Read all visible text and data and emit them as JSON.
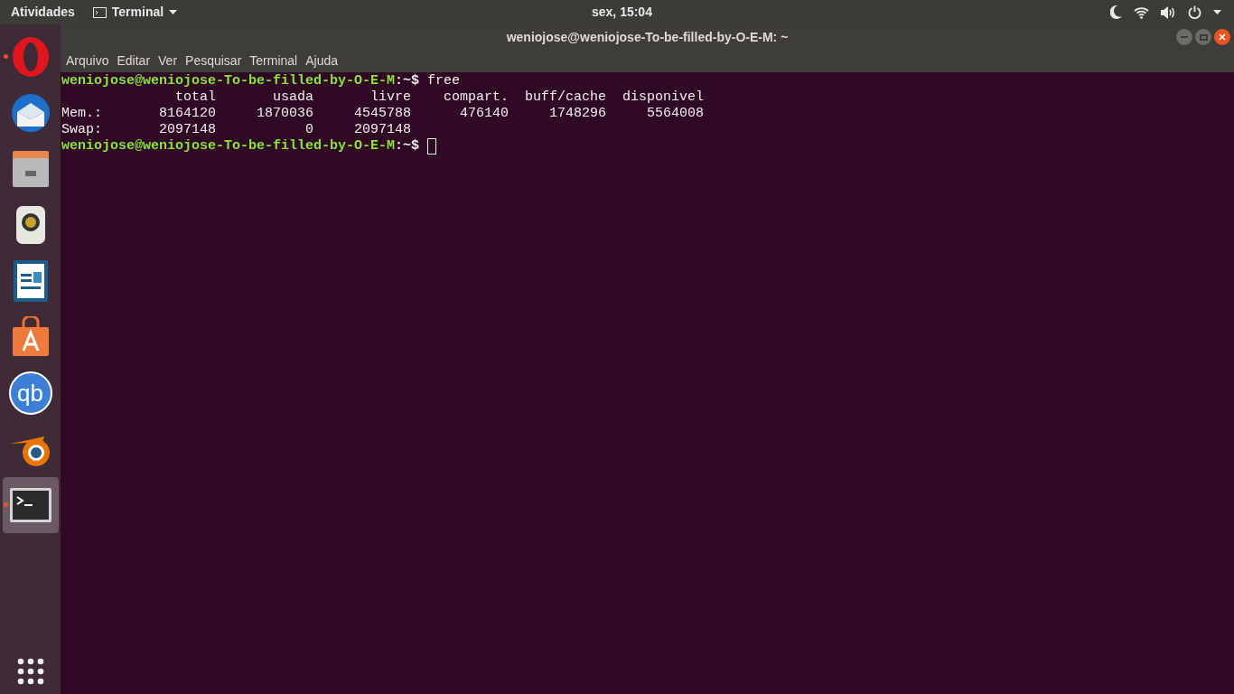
{
  "top_bar": {
    "activities": "Atividades",
    "app_menu": "Terminal",
    "clock": "sex, 15:04"
  },
  "dock": {
    "items": [
      {
        "kind": "opera",
        "running": true,
        "selected": false
      },
      {
        "kind": "thunderbird",
        "running": false,
        "selected": false
      },
      {
        "kind": "files",
        "running": false,
        "selected": false
      },
      {
        "kind": "speaker",
        "running": false,
        "selected": false
      },
      {
        "kind": "writer",
        "running": false,
        "selected": false
      },
      {
        "kind": "store",
        "running": false,
        "selected": false
      },
      {
        "kind": "qbittorrent",
        "glyph": "qb",
        "running": false,
        "selected": false
      },
      {
        "kind": "blender",
        "running": false,
        "selected": false
      },
      {
        "kind": "terminal",
        "running": true,
        "selected": true
      }
    ]
  },
  "window": {
    "title": "weniojose@weniojose-To-be-filled-by-O-E-M: ~",
    "menu": [
      "Arquivo",
      "Editar",
      "Ver",
      "Pesquisar",
      "Terminal",
      "Ajuda"
    ]
  },
  "terminal": {
    "lines": [
      {
        "kind": "prompt",
        "user_host": "weniojose@weniojose-To-be-filled-by-O-E-M",
        "path": ":~$",
        "command": "free"
      },
      {
        "kind": "output",
        "text": "              total       usada       livre    compart.  buff/cache  disponivel"
      },
      {
        "kind": "output",
        "text": "Mem.:       8164120     1870036     4545788      476140     1748296     5564008"
      },
      {
        "kind": "output",
        "text": "Swap:       2097148           0     2097148"
      },
      {
        "kind": "prompt",
        "user_host": "weniojose@weniojose-To-be-filled-by-O-E-M",
        "path": ":~$",
        "cursor": true
      }
    ]
  }
}
